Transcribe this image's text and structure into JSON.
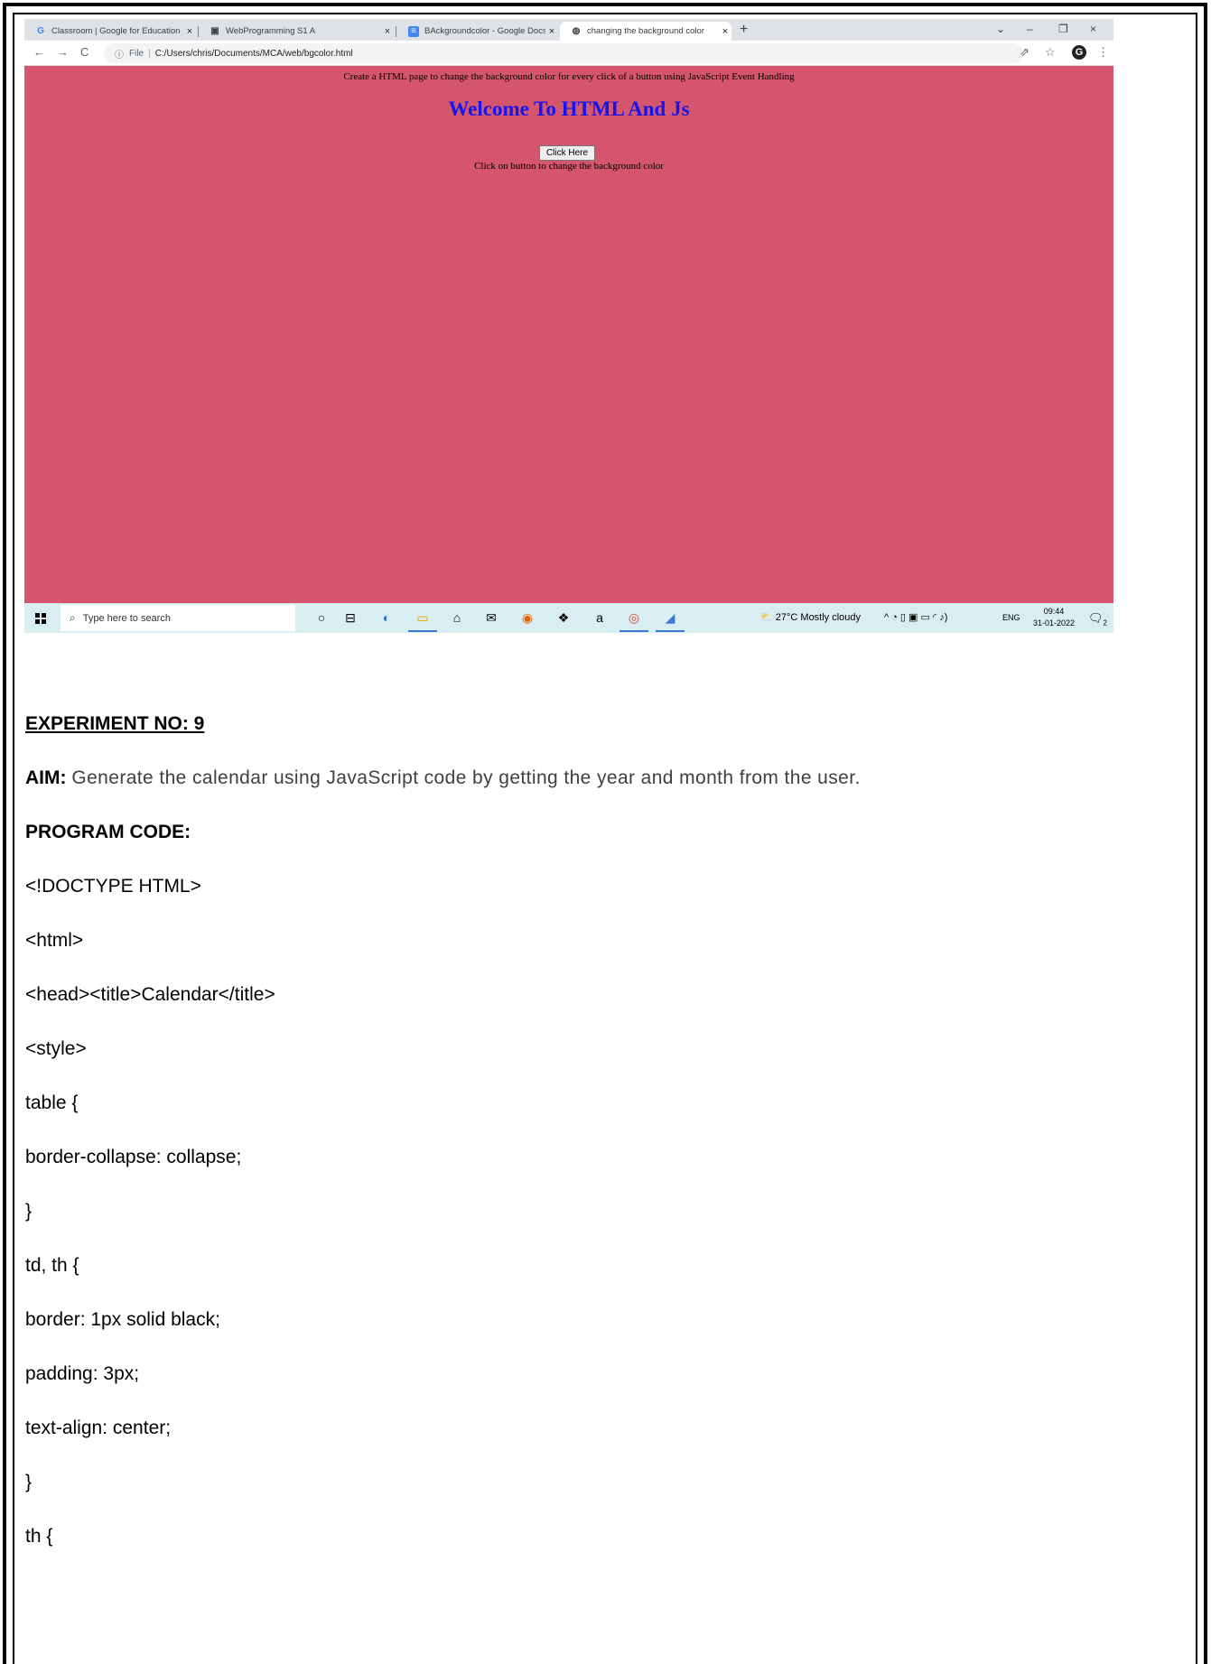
{
  "browser": {
    "tabs": [
      {
        "favicon": "G",
        "title": "Classroom | Google for Education",
        "close": "×"
      },
      {
        "favicon": "▣",
        "title": "WebProgramming S1 A",
        "close": "×"
      },
      {
        "favicon": "≡",
        "title": "BAckgroundcolor - Google Docs",
        "close": "×"
      },
      {
        "favicon": "◍",
        "title": "changing the background color",
        "close": "×"
      }
    ],
    "new_tab": "+",
    "window_controls": [
      "⌄",
      "–",
      "❐",
      "×"
    ],
    "nav": {
      "back": "←",
      "forward": "→",
      "reload": "C"
    },
    "address": {
      "info_icon": "ⓘ",
      "scheme": "File",
      "separator": "|",
      "path": "C:/Users/chris/Documents/MCA/web/bgcolor.html"
    },
    "toolbar_icons": {
      "share": "⇗",
      "star": "☆",
      "profile": "G",
      "menu": "⋮"
    }
  },
  "page": {
    "bg_color": "#d5546e",
    "line1": "Create a HTML page to change the background color for every click of a button using JavaScript Event Handling",
    "heading": "Welcome To HTML And Js",
    "heading_color": "#1515ee",
    "button_label": "Click Here",
    "line2": "Click on button to change the background color"
  },
  "taskbar": {
    "search_placeholder": "Type here to search",
    "icons": [
      "○",
      "⊟",
      "◐",
      "▭",
      "⌂",
      "✉",
      "◉",
      "❖",
      "a",
      "◎",
      "◢"
    ],
    "weather": "27°C  Mostly cloudy",
    "tray_symbols": "^ ◔ ▯ ▣ ▭ ◜ ♪)",
    "language": "ENG",
    "time": "09:44",
    "date": "31-01-2022",
    "notification_count": "2"
  },
  "document": {
    "experiment": "EXPERIMENT NO: 9",
    "aim_label": "AIM:",
    "aim_text": "Generate the calendar using JavaScript code by getting the year and month from the user.",
    "program_code_label": "PROGRAM CODE:",
    "code_lines": [
      "<!DOCTYPE HTML>",
      "<html>",
      "<head><title>Calendar</title>",
      "<style>",
      "table {",
      "border-collapse: collapse;",
      "}",
      "td, th {",
      "border: 1px solid black;",
      "padding: 3px;",
      "text-align: center;",
      "}",
      "th {"
    ]
  }
}
